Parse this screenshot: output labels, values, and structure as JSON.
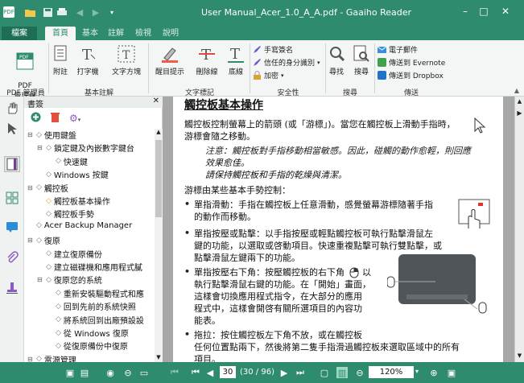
{
  "window": {
    "title": "User Manual_Acer_1.0_A_A.pdf - Gaaiho Reader",
    "minimize": "–",
    "maximize": "□",
    "close": "✕"
  },
  "tabs": {
    "file": "檔案",
    "home": "首頁",
    "basic": "基本",
    "comment": "註解",
    "view": "檢視",
    "help": "說明"
  },
  "ribbon": {
    "pdf_manager": "PDF\n管理員",
    "attach": "附註",
    "typewriter": "打字機",
    "textbox": "文字方塊",
    "highlight": "醒目提示",
    "strikeout": "刪除線",
    "underline": "底線",
    "sign": "手寫簽名",
    "trusted_id": "信任的身分識別",
    "encrypt": "加密",
    "find": "尋找",
    "search": "搜尋",
    "email": "電子郵件",
    "evernote": "傳送到 Evernote",
    "dropbox": "傳送到 Dropbox",
    "groups": {
      "pdf_manager": "PDF 管理員",
      "basic_comment": "基本註解",
      "text_markup": "文字標記",
      "security": "安全性",
      "search": "搜尋",
      "send": "傳送"
    }
  },
  "panel": {
    "title": "書簽",
    "close": "✕"
  },
  "bookmarks": [
    {
      "label": "使用鍵盤",
      "level": 0,
      "expand": "⊟"
    },
    {
      "label": "鎖定鍵及內嵌數字鍵台",
      "level": 1,
      "expand": "⊟"
    },
    {
      "label": "快速鍵",
      "level": 2,
      "expand": ""
    },
    {
      "label": "Windows 按鍵",
      "level": 1,
      "expand": ""
    },
    {
      "label": "觸控板",
      "level": 0,
      "expand": "⊟"
    },
    {
      "label": "觸控板基本操作",
      "level": 1,
      "expand": "",
      "current": true
    },
    {
      "label": "觸控板手勢",
      "level": 1,
      "expand": ""
    },
    {
      "label": "Acer Backup Manager",
      "level": 0,
      "expand": ""
    },
    {
      "label": "復原",
      "level": 0,
      "expand": "⊟"
    },
    {
      "label": "建立復原備份",
      "level": 1,
      "expand": ""
    },
    {
      "label": "建立磁碟機和應用程式膩",
      "level": 1,
      "expand": ""
    },
    {
      "label": "復原您的系統",
      "level": 1,
      "expand": "⊟"
    },
    {
      "label": "重新安裝驅動程式和應",
      "level": 2,
      "expand": ""
    },
    {
      "label": "回到先前的系統快照",
      "level": 2,
      "expand": ""
    },
    {
      "label": "將系統回到出廠預設設",
      "level": 2,
      "expand": ""
    },
    {
      "label": "從 Windows 復原",
      "level": 2,
      "expand": ""
    },
    {
      "label": "從復原備份中復原",
      "level": 2,
      "expand": ""
    },
    {
      "label": "電源管理",
      "level": 0,
      "expand": "⊟"
    }
  ],
  "doc": {
    "heading": "觸控板基本操作",
    "p1a": "觸控板控制螢幕上的箭頭 (或「游標」)。當您在觸控板上滑動手指時，",
    "p1b": "游標會隨之移動。",
    "note1": "注意：觸控板對手指移動相當敏感。因此，碰觸的動作愈輕，則回應",
    "note2": "效果愈佳。",
    "note3": "請保持觸控板和手指的乾燥與清潔。",
    "p2": "游標由某些基本手勢控制：",
    "b1a": "單指滑動：手指在觸控板上任意滑動，感覺螢幕游標隨著手指",
    "b1b": "的動作而移動。",
    "b2a": "單指按壓或點擊：以手指按壓或輕點觸控板可執行點擊滑鼠左",
    "b2b": "鍵的功能，以選取或啓動項目。快速重複點擊可執行雙點擊，或",
    "b2c": "點擊滑鼠左鍵兩下的功能。",
    "b3a": "單指按壓右下角：按壓觸控板的右下角",
    "b3a2": "以",
    "b3b": "執行點擊滑鼠右鍵的功能。在「開始」畫面，",
    "b3c": "這樣會切換應用程式指令，在大部分的應用",
    "b3d": "程式中，這樣會開啓有關所選項目的內容功",
    "b3e": "能表。",
    "b4a": "拖拉：按住觸控板左下角不放，或在觸控板",
    "b4b": "任何位置點兩下，然後將第二隻手指滑過觸控板來選取區域中的所有",
    "b4c": "項目。"
  },
  "status": {
    "page": "30",
    "pagecount": "(30 / 96)",
    "zoom": "120%"
  }
}
